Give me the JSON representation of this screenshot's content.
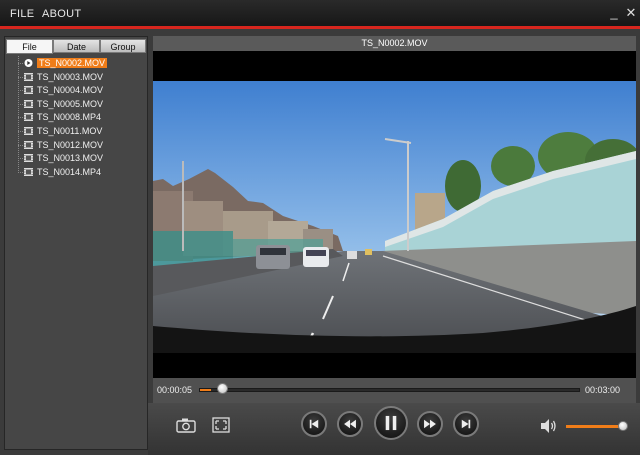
{
  "menu": {
    "file": "FILE",
    "about": "ABOUT"
  },
  "window_controls": {
    "minimize": "_",
    "close": "✕"
  },
  "tabs": [
    {
      "label": "File",
      "active": true
    },
    {
      "label": "Date",
      "active": false
    },
    {
      "label": "Group",
      "active": false
    }
  ],
  "files": [
    {
      "name": "TS_N0002.MOV",
      "selected": true,
      "icon": "play-icon"
    },
    {
      "name": "TS_N0003.MOV",
      "selected": false,
      "icon": "film-icon"
    },
    {
      "name": "TS_N0004.MOV",
      "selected": false,
      "icon": "film-icon"
    },
    {
      "name": "TS_N0005.MOV",
      "selected": false,
      "icon": "film-icon"
    },
    {
      "name": "TS_N0008.MP4",
      "selected": false,
      "icon": "film-icon"
    },
    {
      "name": "TS_N0011.MOV",
      "selected": false,
      "icon": "film-icon"
    },
    {
      "name": "TS_N0012.MOV",
      "selected": false,
      "icon": "film-icon"
    },
    {
      "name": "TS_N0013.MOV",
      "selected": false,
      "icon": "film-icon"
    },
    {
      "name": "TS_N0014.MP4",
      "selected": false,
      "icon": "film-icon"
    }
  ],
  "player": {
    "title": "TS_N0002.MOV",
    "current_time": "00:00:05",
    "total_time": "00:03:00",
    "progress": 0.028,
    "volume": 0.95
  },
  "colors": {
    "accent": "#f07d19",
    "titlebar_line": "#d7261e"
  }
}
